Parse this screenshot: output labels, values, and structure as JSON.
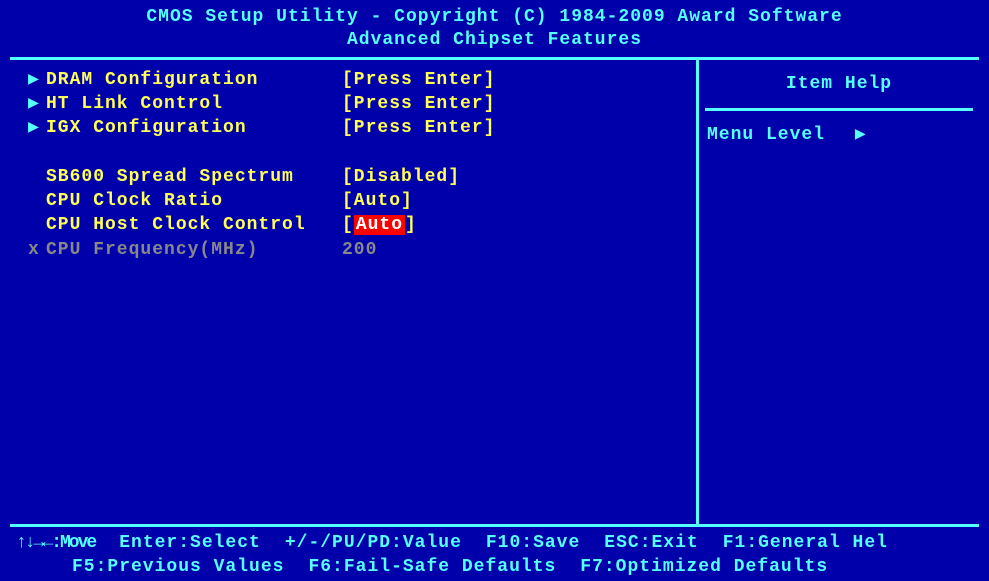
{
  "header": {
    "title": "CMOS Setup Utility - Copyright (C) 1984-2009 Award Software",
    "subtitle": "Advanced Chipset Features"
  },
  "menu": {
    "items": [
      {
        "bullet": "▶",
        "label": "DRAM Configuration",
        "value": "[Press Enter]",
        "type": "submenu"
      },
      {
        "bullet": "▶",
        "label": "HT Link Control",
        "value": "[Press Enter]",
        "type": "submenu"
      },
      {
        "bullet": "▶",
        "label": "IGX Configuration",
        "value": "[Press Enter]",
        "type": "submenu"
      },
      {
        "bullet": "",
        "label": "SB600 Spread Spectrum",
        "value": "[Disabled]",
        "type": "setting"
      },
      {
        "bullet": "",
        "label": "CPU Clock Ratio",
        "value": "[Auto]",
        "type": "setting"
      },
      {
        "bullet": "",
        "label": "CPU Host Clock Control",
        "value_pre": "[",
        "value_hl": "Auto",
        "value_post": "]",
        "type": "highlighted"
      },
      {
        "bullet": "x",
        "label": "CPU Frequency(MHz)",
        "value": "200",
        "type": "disabled"
      }
    ]
  },
  "help": {
    "title": "Item Help",
    "menu_level": "Menu Level",
    "arrow": "▶"
  },
  "footer": {
    "line1": [
      "↑↓→←:Move",
      "Enter:Select",
      "+/-/PU/PD:Value",
      "F10:Save",
      "ESC:Exit",
      "F1:General Hel"
    ],
    "line2": [
      "F5:Previous Values",
      "F6:Fail-Safe Defaults",
      "F7:Optimized Defaults"
    ]
  }
}
